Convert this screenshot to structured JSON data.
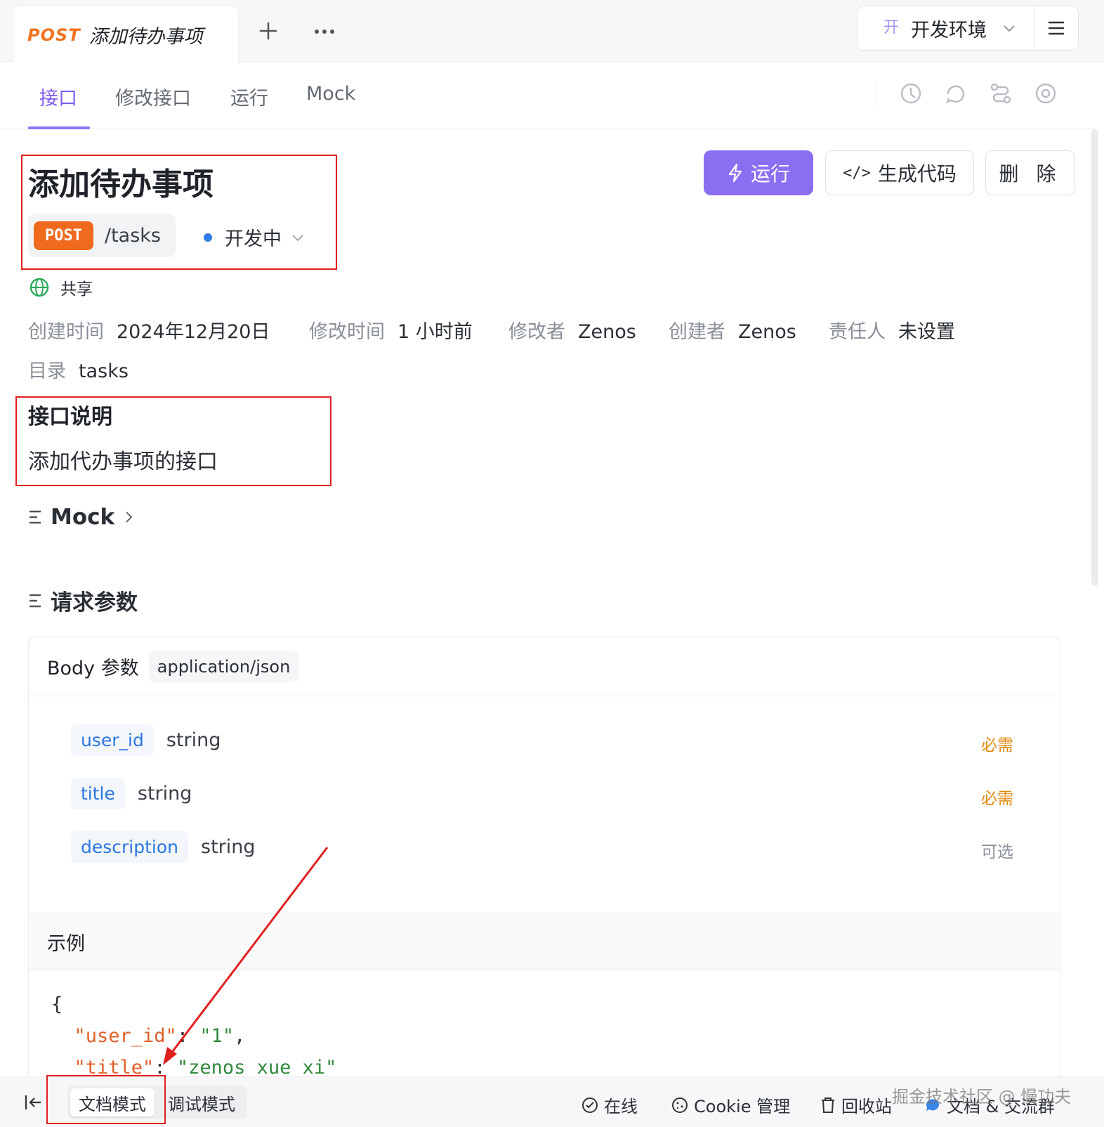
{
  "top_tab": {
    "method": "POST",
    "name": "添加待办事项"
  },
  "env": {
    "badge": "开",
    "name": "开发环境"
  },
  "sub_tabs": [
    "接口",
    "修改接口",
    "运行",
    "Mock"
  ],
  "api": {
    "title": "添加待办事项",
    "method": "POST",
    "path": "/tasks",
    "status": "开发中",
    "status_color": "#2f7be8",
    "share": "共享"
  },
  "actions": {
    "run": "运行",
    "gen_code": "生成代码",
    "delete": "删 除",
    "code_icon": "</>"
  },
  "meta": [
    {
      "key": "创建时间",
      "value": "2024年12月20日"
    },
    {
      "key": "修改时间",
      "value": "1 小时前"
    },
    {
      "key": "修改者",
      "value": "Zenos"
    },
    {
      "key": "创建者",
      "value": "Zenos"
    },
    {
      "key": "责任人",
      "value": "未设置"
    }
  ],
  "directory": {
    "key": "目录",
    "value": "tasks"
  },
  "description": {
    "heading": "接口说明",
    "text": "添加代办事项的接口"
  },
  "sections": {
    "mock": "Mock",
    "request_params": "请求参数"
  },
  "body": {
    "label": "Body 参数",
    "content_type": "application/json",
    "params": [
      {
        "name": "user_id",
        "type": "string",
        "required": "必需"
      },
      {
        "name": "title",
        "type": "string",
        "required": "必需"
      },
      {
        "name": "description",
        "type": "string",
        "required": "可选"
      }
    ],
    "example_label": "示例",
    "example": {
      "open_brace": "{",
      "lines": [
        {
          "key": "\"user_id\"",
          "value": "\"1\""
        },
        {
          "key": "\"title\"",
          "value": "\"zenos xue xi\""
        }
      ]
    }
  },
  "bottom": {
    "modes": [
      "文档模式",
      "调试模式"
    ],
    "online": "在线",
    "cookie": "Cookie 管理",
    "recycle": "回收站",
    "docs": "文档 & 交流群",
    "watermark": "掘金技术社区 @ 慢功夫"
  },
  "colors": {
    "accent": "#8b6ff2",
    "post": "#f06a1d",
    "annotation": "#e0201f"
  }
}
